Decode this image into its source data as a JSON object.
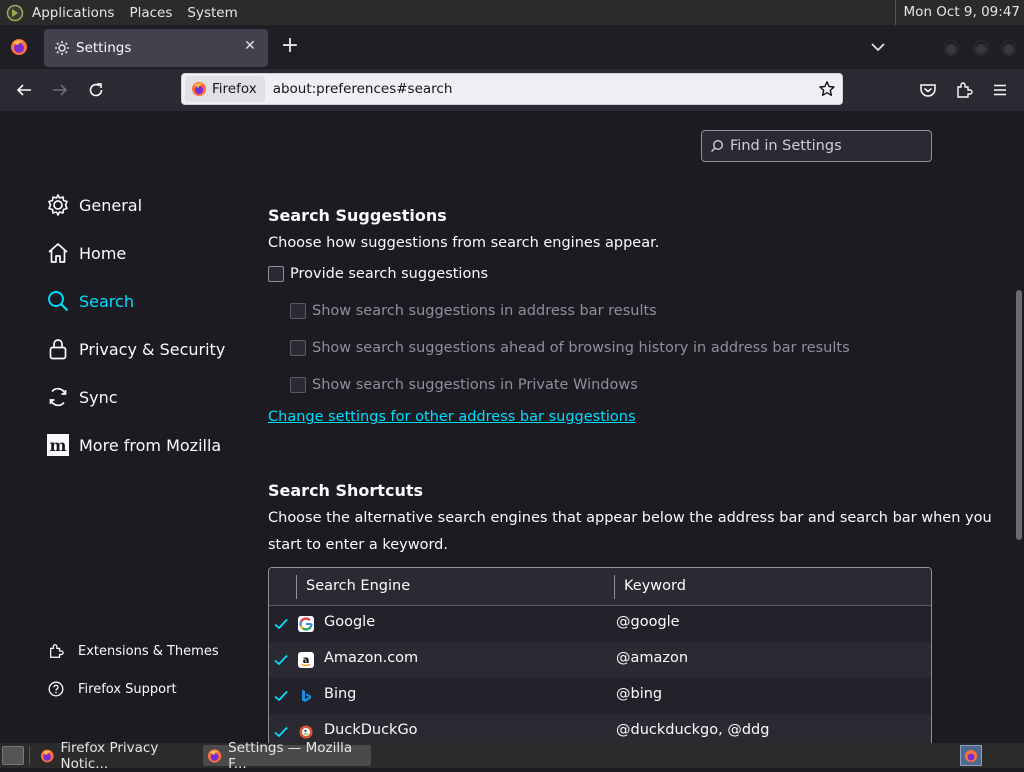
{
  "top_panel": {
    "menus": [
      "Applications",
      "Places",
      "System"
    ],
    "clock": "Mon Oct  9, 09:47"
  },
  "tab": {
    "title": "Settings"
  },
  "urlbar": {
    "identity": "Firefox",
    "url": "about:preferences#search"
  },
  "find": {
    "placeholder": "Find in Settings"
  },
  "sidebar": {
    "items": [
      {
        "label": "General",
        "icon": "gear-icon"
      },
      {
        "label": "Home",
        "icon": "home-icon"
      },
      {
        "label": "Search",
        "icon": "search-icon",
        "selected": true
      },
      {
        "label": "Privacy & Security",
        "icon": "lock-icon"
      },
      {
        "label": "Sync",
        "icon": "sync-icon"
      },
      {
        "label": "More from Mozilla",
        "icon": "mozilla-icon"
      }
    ],
    "footer": [
      {
        "label": "Extensions & Themes",
        "icon": "puzzle-icon"
      },
      {
        "label": "Firefox Support",
        "icon": "help-icon"
      }
    ]
  },
  "suggestions": {
    "heading": "Search Suggestions",
    "description": "Choose how suggestions from search engines appear.",
    "provide": "Provide search suggestions",
    "sub_options": [
      "Show search suggestions in address bar results",
      "Show search suggestions ahead of browsing history in address bar results",
      "Show search suggestions in Private Windows"
    ],
    "link": "Change settings for other address bar suggestions"
  },
  "shortcuts": {
    "heading": "Search Shortcuts",
    "description_line1": "Choose the alternative search engines that appear below the address bar and search bar when you",
    "description_line2": "start to enter a keyword.",
    "columns": [
      "Search Engine",
      "Keyword"
    ],
    "rows": [
      {
        "name": "Google",
        "keyword": "@google",
        "checked": true,
        "icon": "google-icon"
      },
      {
        "name": "Amazon.com",
        "keyword": "@amazon",
        "checked": true,
        "icon": "amazon-icon"
      },
      {
        "name": "Bing",
        "keyword": "@bing",
        "checked": true,
        "icon": "bing-icon"
      },
      {
        "name": "DuckDuckGo",
        "keyword": "@duckduckgo, @ddg",
        "checked": true,
        "icon": "duckduckgo-icon"
      }
    ]
  },
  "taskbar": {
    "tasks": [
      {
        "label": "Firefox Privacy Notic...",
        "active": false
      },
      {
        "label": "Settings — Mozilla F...",
        "active": true
      }
    ]
  },
  "colors": {
    "accent": "#00ddff",
    "background": "#1c1b22",
    "toolbar": "#2b2a33"
  }
}
